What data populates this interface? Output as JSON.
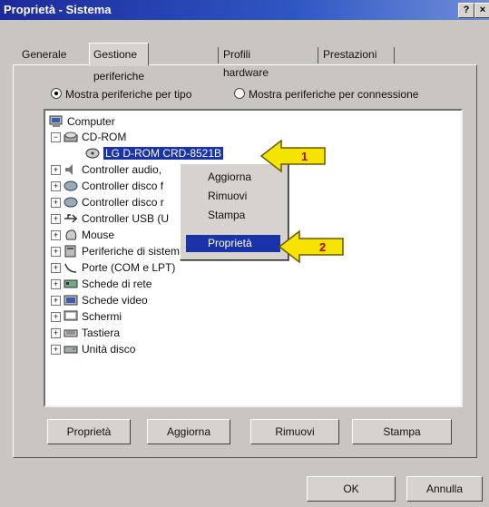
{
  "window": {
    "title": "Proprietà - Sistema",
    "help_btn": "?",
    "close_btn": "×"
  },
  "tabs": [
    "Generale",
    "Gestione periferiche",
    "Profili hardware",
    "Prestazioni"
  ],
  "radios": {
    "by_type": "Mostra periferiche per tipo",
    "by_connection": "Mostra periferiche per connessione"
  },
  "tree": {
    "root": "Computer",
    "cdrom_group": "CD-ROM",
    "cdrom_device": "LG  D-ROM CRD-8521B",
    "items": [
      "Controller audio,",
      "Controller disco f",
      "Controller disco r",
      "Controller USB (U",
      "Mouse",
      "Periferiche di sistema",
      "Porte (COM e LPT)",
      "Schede di rete",
      "Schede video",
      "Schermi",
      "Tastiera",
      "Unità disco"
    ]
  },
  "context_menu": [
    "Aggiorna",
    "Rimuovi",
    "Stampa",
    "Proprietà"
  ],
  "callouts": [
    "1",
    "2"
  ],
  "buttons": {
    "properties": "Proprietà",
    "update": "Aggiorna",
    "remove": "Rimuovi",
    "print": "Stampa",
    "ok": "OK",
    "cancel": "Annulla"
  },
  "colors": {
    "selection": "#1a33a8",
    "callout": "#f5e400",
    "titlebar": "#1c2a9a"
  }
}
